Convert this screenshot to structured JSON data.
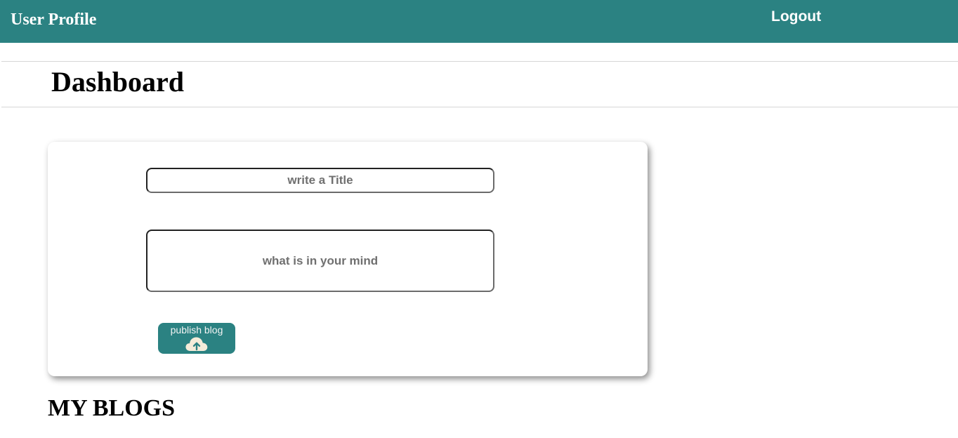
{
  "header": {
    "brand": "User Profile",
    "logout_label": "Logout"
  },
  "page": {
    "title": "Dashboard"
  },
  "composer": {
    "title_placeholder": "write a Title",
    "body_placeholder": "what is in your mind",
    "publish_label": "publish blog",
    "publish_icon": "cloud-upload-icon"
  },
  "blogs": {
    "heading": "MY BLOGS"
  },
  "colors": {
    "accent": "#2b8282",
    "icon_fill": "#f5ecd9"
  }
}
